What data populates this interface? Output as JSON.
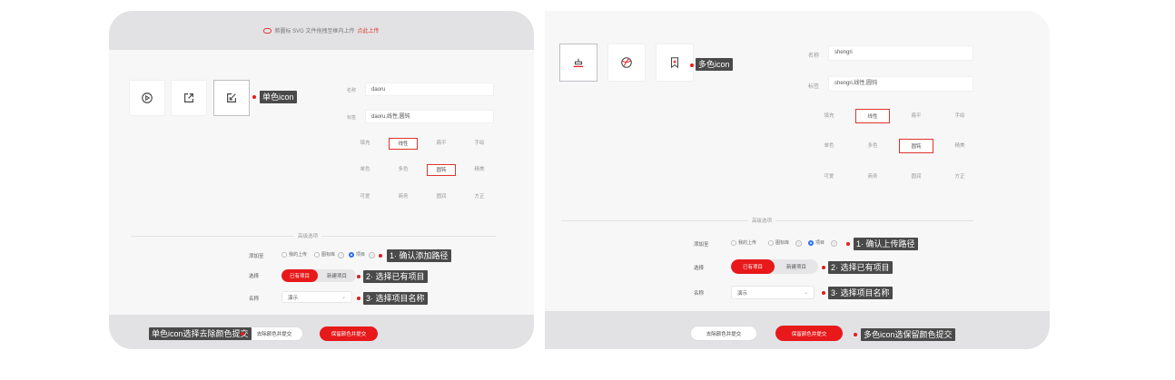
{
  "left": {
    "topbar": {
      "text": "將圖标 SVG 文件拖拽至框内上传",
      "link": "点此上传"
    },
    "fields": {
      "name_label": "名称",
      "name_value": "daoru",
      "tags_label": "标签",
      "tags_value": "daoru,线性,圆钝"
    },
    "tags": [
      [
        "填充",
        "线性",
        "扁平",
        "手绘"
      ],
      [
        "单色",
        "多色",
        "圆钝",
        "精美"
      ],
      [
        "可爱",
        "商务",
        "圆润",
        "方正"
      ]
    ],
    "section_title": "高级选项",
    "add_label": "添加至",
    "radios": [
      "我的上传",
      "图标库",
      "项目"
    ],
    "select_label": "选择",
    "seg": [
      "已有项目",
      "新建项目"
    ],
    "name_row_label": "名称",
    "select_value": "演示",
    "btn_white": "去除颜色并提交",
    "btn_red": "保留颜色并提交",
    "callouts": {
      "single": "单色icon",
      "step1": "1· 确认添加路径",
      "step2": "2· 选择已有项目",
      "step3": "3· 选择项目名称",
      "bottom": "单色icon选择去除颜色提交"
    }
  },
  "right": {
    "fields": {
      "name_label": "名称",
      "name_value": "shengri",
      "tags_label": "标签",
      "tags_value": "shengri,线性,圆钝"
    },
    "tags": [
      [
        "填充",
        "线性",
        "扁平",
        "手绘"
      ],
      [
        "单色",
        "多色",
        "圆钝",
        "精美"
      ],
      [
        "可爱",
        "商务",
        "圆润",
        "方正"
      ]
    ],
    "section_title": "高级选项",
    "add_label": "添加至",
    "radios": [
      "我的上传",
      "图标库",
      "项目"
    ],
    "select_label": "选择",
    "seg": [
      "已有项目",
      "新建项目"
    ],
    "name_row_label": "名称",
    "select_value": "演示",
    "btn_white": "去除颜色并提交",
    "btn_red": "保留颜色并提交",
    "callouts": {
      "multi": "多色icon",
      "step1": "1· 确认上传路径",
      "step2": "2· 选择已有项目",
      "step3": "3· 选择项目名称",
      "bottom": "多色icon选保留颜色提交"
    }
  },
  "colors": {
    "accent": "#e7191b",
    "radio_on": "#2d6bf0",
    "callout_bg": "#4a4a4a"
  },
  "icons": [
    "play-circle-icon",
    "external-link-icon",
    "edit-square-icon",
    "cake-icon",
    "ball-icon",
    "bookmark-plus-icon",
    "cloud-upload-icon",
    "chevron-down-icon"
  ]
}
